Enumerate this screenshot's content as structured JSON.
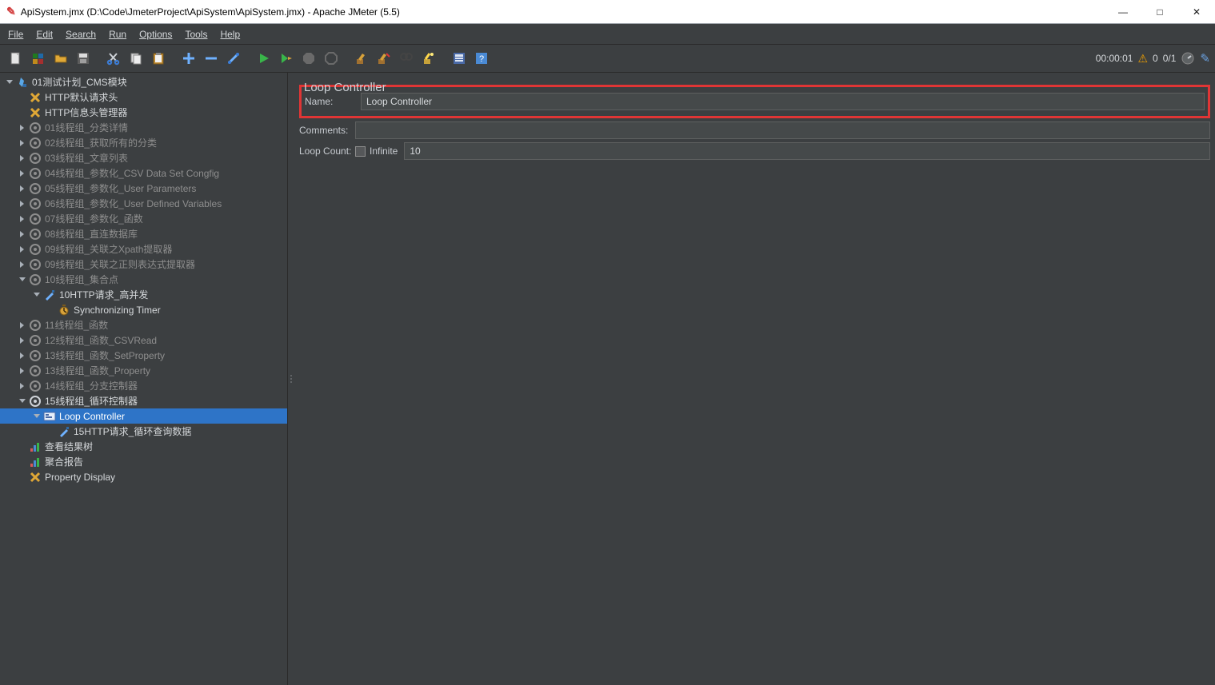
{
  "window": {
    "title": "ApiSystem.jmx (D:\\Code\\JmeterProject\\ApiSystem\\ApiSystem.jmx) - Apache JMeter (5.5)"
  },
  "menu": {
    "file": "File",
    "edit": "Edit",
    "search": "Search",
    "run": "Run",
    "options": "Options",
    "tools": "Tools",
    "help": "Help"
  },
  "status": {
    "elapsed": "00:00:01",
    "warn_count": "0",
    "threads": "0/1"
  },
  "editor": {
    "panel_title": "Loop Controller",
    "name_label": "Name:",
    "name_value": "Loop Controller",
    "comments_label": "Comments:",
    "comments_value": "",
    "loop_label": "Loop Count:",
    "infinite_label": "Infinite",
    "loop_value": "10"
  },
  "tree": {
    "0": "01测试计划_CMS模块",
    "1": "HTTP默认请求头",
    "2": "HTTP信息头管理器",
    "3": "01线程组_分类详情",
    "4": "02线程组_获取所有的分类",
    "5": "03线程组_文章列表",
    "6": "04线程组_参数化_CSV Data Set Congfig",
    "7": "05线程组_参数化_User Parameters",
    "8": "06线程组_参数化_User Defined Variables",
    "9": "07线程组_参数化_函数",
    "10": "08线程组_直连数据库",
    "11": "09线程组_关联之Xpath提取器",
    "12": "09线程组_关联之正则表达式提取器",
    "13": "10线程组_集合点",
    "14": "10HTTP请求_高并发",
    "15": "Synchronizing Timer",
    "16": "11线程组_函数",
    "17": "12线程组_函数_CSVRead",
    "18": "13线程组_函数_SetProperty",
    "19": "13线程组_函数_Property",
    "20": "14线程组_分支控制器",
    "21": "15线程组_循环控制器",
    "22": "Loop Controller",
    "23": "15HTTP请求_循环查询数据",
    "24": "查看结果树",
    "25": "聚合报告",
    "26": "Property Display"
  }
}
